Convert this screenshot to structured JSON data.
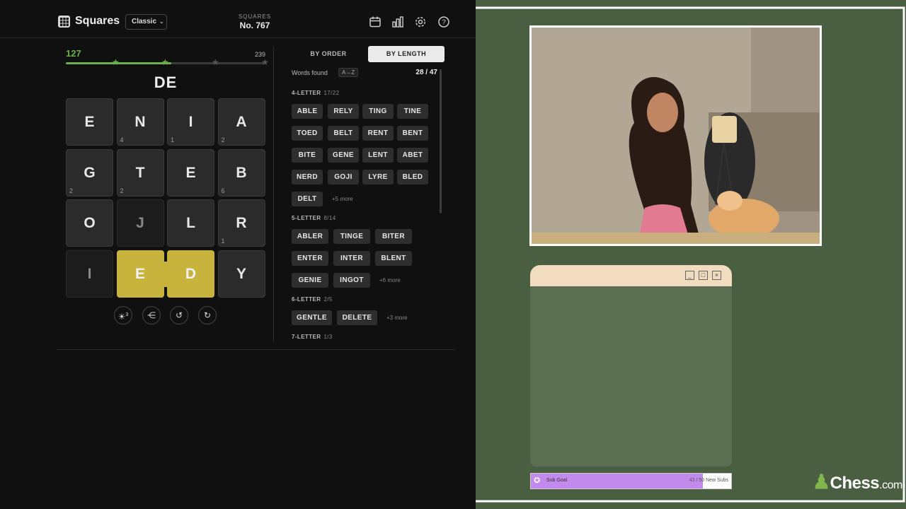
{
  "header": {
    "app_name": "Squares",
    "mode": "Classic",
    "puzzle_label": "SQUARES",
    "puzzle_number": "No. 767",
    "icons": [
      "calendar-icon",
      "stats-icon",
      "gear-icon",
      "help-icon"
    ]
  },
  "progress": {
    "score": "127",
    "max": "239",
    "fraction": 0.53
  },
  "current_word": "DE",
  "grid": [
    {
      "letter": "E",
      "count": "",
      "state": "normal"
    },
    {
      "letter": "N",
      "count": "4",
      "state": "normal"
    },
    {
      "letter": "I",
      "count": "1",
      "state": "normal"
    },
    {
      "letter": "A",
      "count": "2",
      "state": "normal"
    },
    {
      "letter": "G",
      "count": "2",
      "state": "normal"
    },
    {
      "letter": "T",
      "count": "2",
      "state": "normal"
    },
    {
      "letter": "E",
      "count": "",
      "state": "normal"
    },
    {
      "letter": "B",
      "count": "6",
      "state": "normal"
    },
    {
      "letter": "O",
      "count": "",
      "state": "normal"
    },
    {
      "letter": "J",
      "count": "",
      "state": "dim"
    },
    {
      "letter": "L",
      "count": "",
      "state": "normal"
    },
    {
      "letter": "R",
      "count": "1",
      "state": "normal"
    },
    {
      "letter": "I",
      "count": "",
      "state": "dim"
    },
    {
      "letter": "E",
      "count": "",
      "state": "selected"
    },
    {
      "letter": "D",
      "count": "",
      "state": "selected"
    },
    {
      "letter": "Y",
      "count": "",
      "state": "normal"
    }
  ],
  "tools": {
    "hint_count": "3"
  },
  "sort": {
    "by_order": "BY ORDER",
    "by_length": "BY LENGTH"
  },
  "words_found": {
    "label": "Words found",
    "sort_badge": "A→Z",
    "count": "28 / 47"
  },
  "sections": [
    {
      "title": "4-LETTER",
      "progress": "17/22",
      "words": [
        "ABLE",
        "RELY",
        "TING",
        "TINE",
        "TOED",
        "BELT",
        "RENT",
        "BENT",
        "BITE",
        "GENE",
        "LENT",
        "ABET",
        "NERD",
        "GOJI",
        "LYRE",
        "BLED",
        "DELT"
      ],
      "more": "+5 more"
    },
    {
      "title": "5-LETTER",
      "progress": "8/14",
      "words": [
        "ABLER",
        "TINGE",
        "BITER",
        "ENTER",
        "INTER",
        "BLENT",
        "GENIE",
        "INGOT"
      ],
      "more": "+6 more"
    },
    {
      "title": "6-LETTER",
      "progress": "2/5",
      "words": [
        "GENTLE",
        "DELETE"
      ],
      "more": "+3 more"
    },
    {
      "title": "7-LETTER",
      "progress": "1/3",
      "words": [],
      "more": ""
    }
  ],
  "sub_goal": {
    "label": "Sub Goal",
    "value": "43 / 50 New Subs",
    "fraction": 0.86,
    "color": "#c38aed"
  },
  "brand": {
    "name": "Chess",
    "suffix": ".com",
    "color": "#81b64c"
  }
}
